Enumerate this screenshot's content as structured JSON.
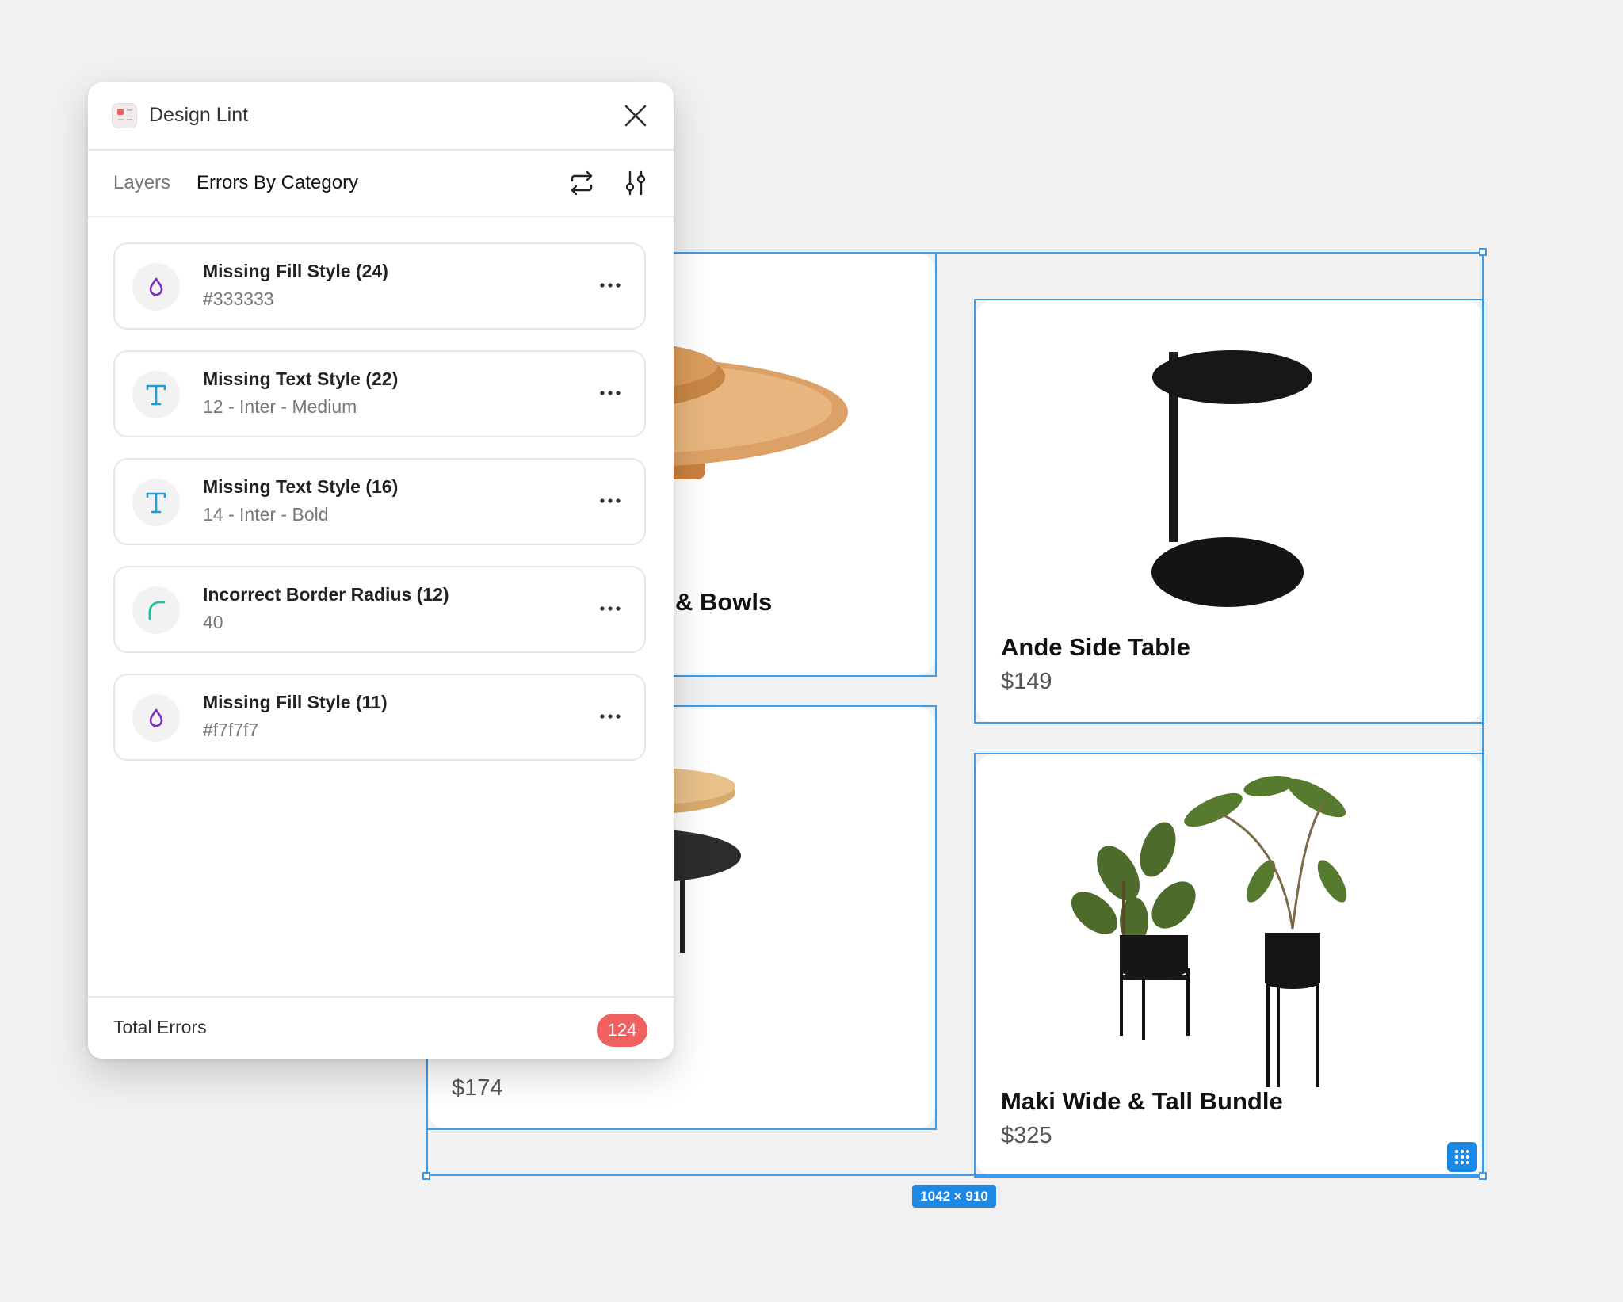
{
  "app": {
    "title": "Design Lint"
  },
  "tabs": [
    {
      "label": "Layers",
      "active": false
    },
    {
      "label": "Errors By Category",
      "active": true
    }
  ],
  "toolbar": {
    "icons": [
      "refresh-icon",
      "settings-sliders-icon"
    ]
  },
  "errors": [
    {
      "title": "Missing Fill Style (24)",
      "detail": "#333333",
      "icon": "fill-drop-icon",
      "icon_color": "#7b2fbf"
    },
    {
      "title": "Missing Text Style (22)",
      "detail": "12 - Inter - Medium",
      "icon": "text-icon",
      "icon_color": "#1f9bd7"
    },
    {
      "title": "Missing Text Style (16)",
      "detail": "14 - Inter - Bold",
      "icon": "text-icon",
      "icon_color": "#1f9bd7"
    },
    {
      "title": "Incorrect Border Radius (12)",
      "detail": "40",
      "icon": "border-radius-icon",
      "icon_color": "#19c39a"
    },
    {
      "title": "Missing Fill Style (11)",
      "detail": "#f7f7f7",
      "icon": "fill-drop-icon",
      "icon_color": "#7b2fbf"
    }
  ],
  "footer": {
    "label": "Total Errors",
    "count": "124",
    "badge_color": "#f06060"
  },
  "canvas": {
    "cards": [
      {
        "title": "& Bowls",
        "price": ""
      },
      {
        "title": "Ande Side Table",
        "price": "$149"
      },
      {
        "title": "",
        "price": "$174"
      },
      {
        "title": "Maki Wide & Tall Bundle",
        "price": "$325"
      }
    ],
    "selection_size": "1042 × 910",
    "selection_color": "#3d9be9"
  }
}
